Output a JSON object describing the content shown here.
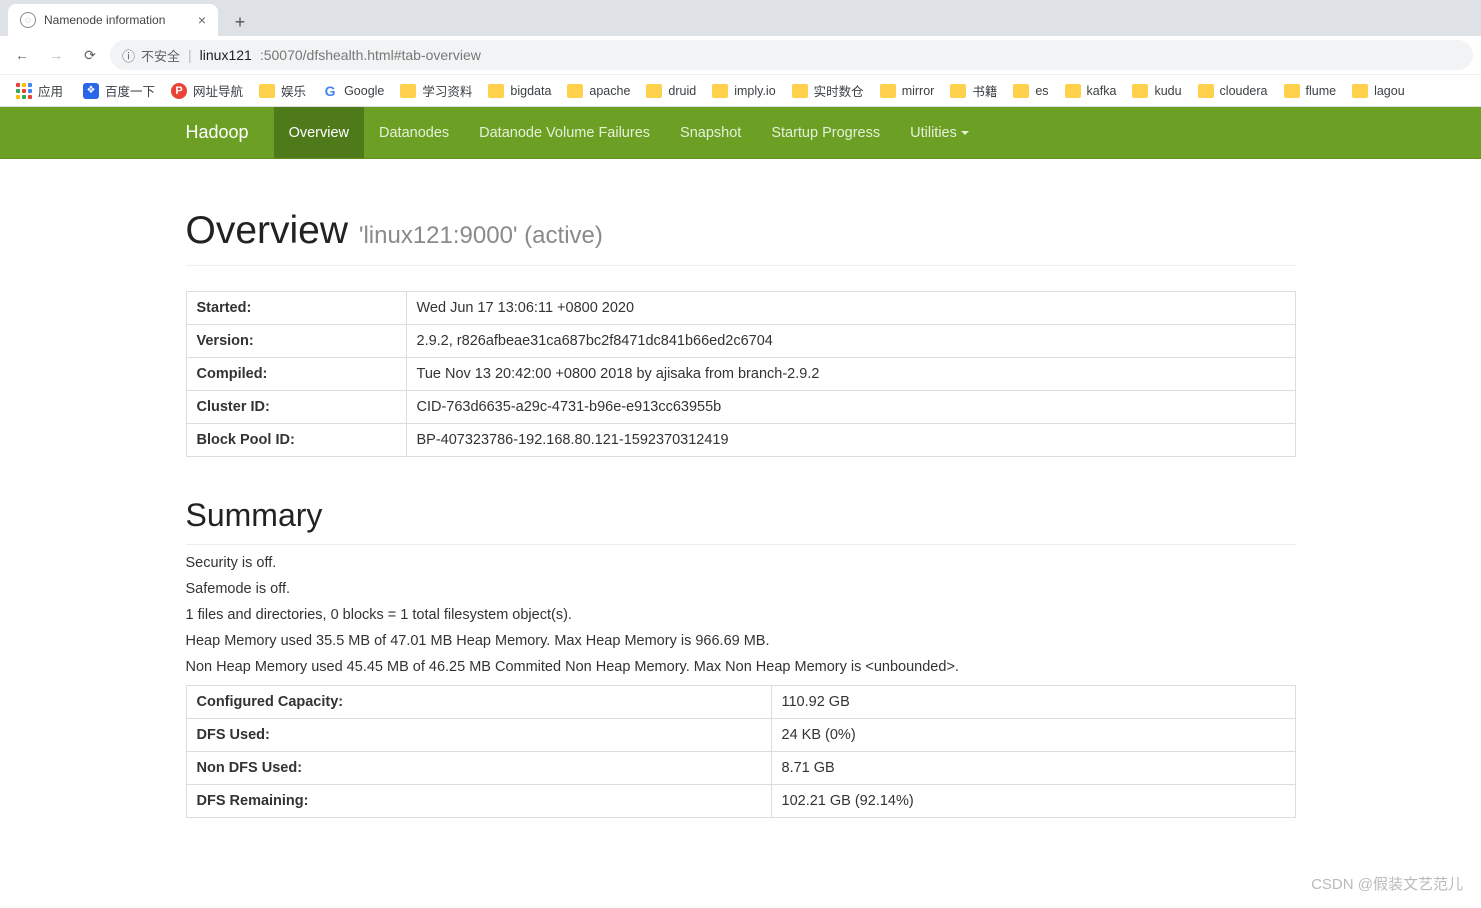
{
  "browser": {
    "tab_title": "Namenode information",
    "security_label": "不安全",
    "url_host": "linux121",
    "url_path": ":50070/dfshealth.html#tab-overview",
    "apps_label": "应用",
    "bookmarks": [
      {
        "icon": "baidu",
        "label": "百度一下"
      },
      {
        "icon": "p",
        "label": "网址导航"
      },
      {
        "icon": "folder",
        "label": "娱乐"
      },
      {
        "icon": "google",
        "label": "Google"
      },
      {
        "icon": "folder",
        "label": "学习资料"
      },
      {
        "icon": "folder",
        "label": "bigdata"
      },
      {
        "icon": "folder",
        "label": "apache"
      },
      {
        "icon": "folder",
        "label": "druid"
      },
      {
        "icon": "folder",
        "label": "imply.io"
      },
      {
        "icon": "folder",
        "label": "实时数仓"
      },
      {
        "icon": "folder",
        "label": "mirror"
      },
      {
        "icon": "folder",
        "label": "书籍"
      },
      {
        "icon": "folder",
        "label": "es"
      },
      {
        "icon": "folder",
        "label": "kafka"
      },
      {
        "icon": "folder",
        "label": "kudu"
      },
      {
        "icon": "folder",
        "label": "cloudera"
      },
      {
        "icon": "folder",
        "label": "flume"
      },
      {
        "icon": "folder",
        "label": "lagou"
      }
    ]
  },
  "nav": {
    "brand": "Hadoop",
    "items": [
      "Overview",
      "Datanodes",
      "Datanode Volume Failures",
      "Snapshot",
      "Startup Progress",
      "Utilities"
    ]
  },
  "page": {
    "h1": "Overview",
    "h1_sub": "'linux121:9000' (active)",
    "summary_heading": "Summary",
    "info_rows": [
      {
        "k": "Started:",
        "v": "Wed Jun 17 13:06:11 +0800 2020"
      },
      {
        "k": "Version:",
        "v": "2.9.2, r826afbeae31ca687bc2f8471dc841b66ed2c6704"
      },
      {
        "k": "Compiled:",
        "v": "Tue Nov 13 20:42:00 +0800 2018 by ajisaka from branch-2.9.2"
      },
      {
        "k": "Cluster ID:",
        "v": "CID-763d6635-a29c-4731-b96e-e913cc63955b"
      },
      {
        "k": "Block Pool ID:",
        "v": "BP-407323786-192.168.80.121-1592370312419"
      }
    ],
    "paras": [
      "Security is off.",
      "Safemode is off.",
      "1 files and directories, 0 blocks = 1 total filesystem object(s).",
      "Heap Memory used 35.5 MB of 47.01 MB Heap Memory. Max Heap Memory is 966.69 MB.",
      "Non Heap Memory used 45.45 MB of 46.25 MB Commited Non Heap Memory. Max Non Heap Memory is <unbounded>."
    ],
    "summary_rows": [
      {
        "k": "Configured Capacity:",
        "v": "110.92 GB"
      },
      {
        "k": "DFS Used:",
        "v": "24 KB (0%)"
      },
      {
        "k": "Non DFS Used:",
        "v": "8.71 GB"
      },
      {
        "k": "DFS Remaining:",
        "v": "102.21 GB (92.14%)"
      }
    ]
  },
  "watermark": "CSDN @假装文艺范儿"
}
